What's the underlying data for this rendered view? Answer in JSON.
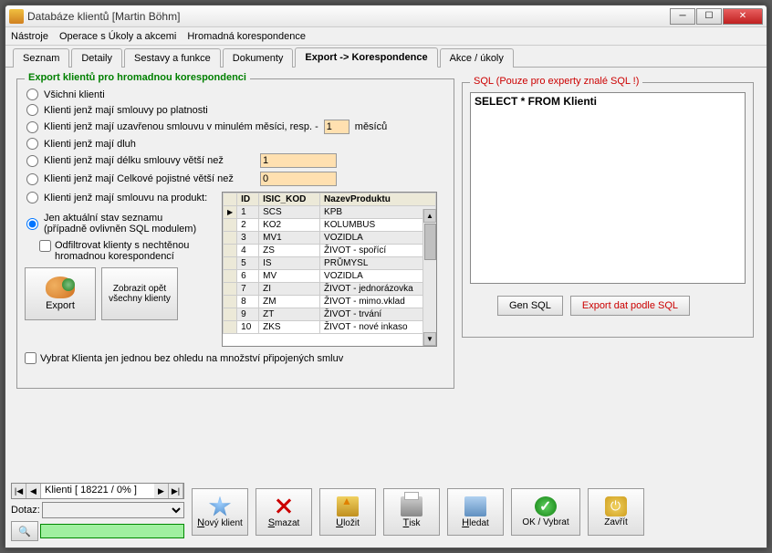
{
  "window": {
    "title": "Databáze klientů   [Martin Böhm]"
  },
  "menu": {
    "items": [
      "Nástroje",
      "Operace s Úkoly a akcemi",
      "Hromadná korespondence"
    ]
  },
  "tabs": {
    "items": [
      "Seznam",
      "Detaily",
      "Sestavy a funkce",
      "Dokumenty",
      "Export -> Korespondence",
      "Akce / úkoly"
    ],
    "active": 4
  },
  "export_group": {
    "legend": "Export klientů pro hromadnou korespondenci",
    "radios": {
      "r1": "Všichni klienti",
      "r2": "Klienti jenž mají smlouvy po platnosti",
      "r3_a": "Klienti jenž mají uzavřenou smlouvu v minulém měsíci, resp. -",
      "r3_val": "1",
      "r3_b": "měsíců",
      "r4": "Klienti jenž mají dluh",
      "r5": "Klienti jenž mají délku smlouvy větší než",
      "r5_val": "1",
      "r6": "Klienti jenž mají Celkové pojistné větší než",
      "r6_val": "0",
      "r7": "Klienti jenž mají smlouvu na produkt:",
      "r8_a": "Jen aktuální stav seznamu",
      "r8_b": "(případně ovlivněn SQL modulem)"
    },
    "chk_filter": "Odfiltrovat klienty s nechtěnou hromadnou korespondencí",
    "btn_export": "Export",
    "btn_showall": "Zobrazit opět všechny klienty",
    "chk_once": "Vybrat Klienta jen jednou bez ohledu na množství připojených smluv"
  },
  "grid": {
    "headers": [
      "ID",
      "ISIC_KOD",
      "NazevProduktu"
    ],
    "rows": [
      {
        "id": "1",
        "kod": "SCS",
        "name": "KPB"
      },
      {
        "id": "2",
        "kod": "KO2",
        "name": "KOLUMBUS"
      },
      {
        "id": "3",
        "kod": "MV1",
        "name": "VOZIDLA"
      },
      {
        "id": "4",
        "kod": "ZS",
        "name": "ŽIVOT - spořící"
      },
      {
        "id": "5",
        "kod": "IS",
        "name": "PRŮMYSL"
      },
      {
        "id": "6",
        "kod": "MV",
        "name": "VOZIDLA"
      },
      {
        "id": "7",
        "kod": "ZI",
        "name": "ŽIVOT - jednorázovka"
      },
      {
        "id": "8",
        "kod": "ZM",
        "name": "ŽIVOT - mimo.vklad"
      },
      {
        "id": "9",
        "kod": "ZT",
        "name": "ŽIVOT - trvání"
      },
      {
        "id": "10",
        "kod": "ZKS",
        "name": "ŽIVOT - nové inkaso"
      }
    ]
  },
  "sql_group": {
    "legend": "SQL (Pouze pro experty znalé SQL !)",
    "text": "SELECT * FROM Klienti",
    "btn_gen": "Gen SQL",
    "btn_exp": "Export dat podle SQL"
  },
  "nav": {
    "counter": "Klienti [ 18221 / 0% ]",
    "dotaz_label": "Dotaz:"
  },
  "toolbar": {
    "new": "Nový klient",
    "del": "Smazat",
    "save": "Uložit",
    "print": "Tisk",
    "find": "Hledat",
    "ok": "OK / Vybrat",
    "close": "Zavřít"
  }
}
